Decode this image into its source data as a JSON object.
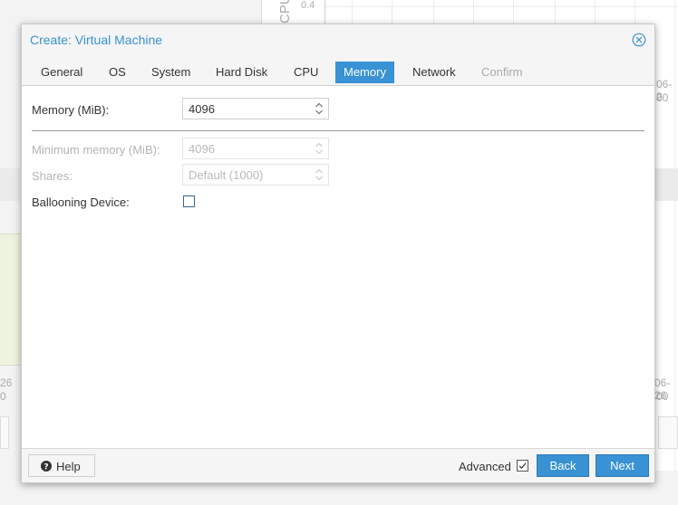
{
  "background": {
    "chart_axis_label": "CPU",
    "chart_tick": "0.4",
    "left_date": "26",
    "left_time": "0",
    "right_date_top": "06-2",
    "right_time_top": "00",
    "right_date_bottom": "06-26",
    "right_time_bottom": "00"
  },
  "dialog": {
    "title": "Create: Virtual Machine",
    "tabs": [
      {
        "label": "General",
        "state": "normal"
      },
      {
        "label": "OS",
        "state": "normal"
      },
      {
        "label": "System",
        "state": "normal"
      },
      {
        "label": "Hard Disk",
        "state": "normal"
      },
      {
        "label": "CPU",
        "state": "normal"
      },
      {
        "label": "Memory",
        "state": "active"
      },
      {
        "label": "Network",
        "state": "normal"
      },
      {
        "label": "Confirm",
        "state": "disabled"
      }
    ],
    "fields": {
      "memory": {
        "label": "Memory (MiB):",
        "value": "4096"
      },
      "min_memory": {
        "label": "Minimum memory (MiB):",
        "value": "4096"
      },
      "shares": {
        "label": "Shares:",
        "value": "Default (1000)"
      },
      "ballooning": {
        "label": "Ballooning Device:",
        "checked": false
      }
    },
    "footer": {
      "help_label": "Help",
      "advanced_label": "Advanced",
      "advanced_checked": true,
      "back_label": "Back",
      "next_label": "Next"
    }
  },
  "colors": {
    "accent": "#3892d3",
    "disabled_text": "#b4b4b4"
  }
}
